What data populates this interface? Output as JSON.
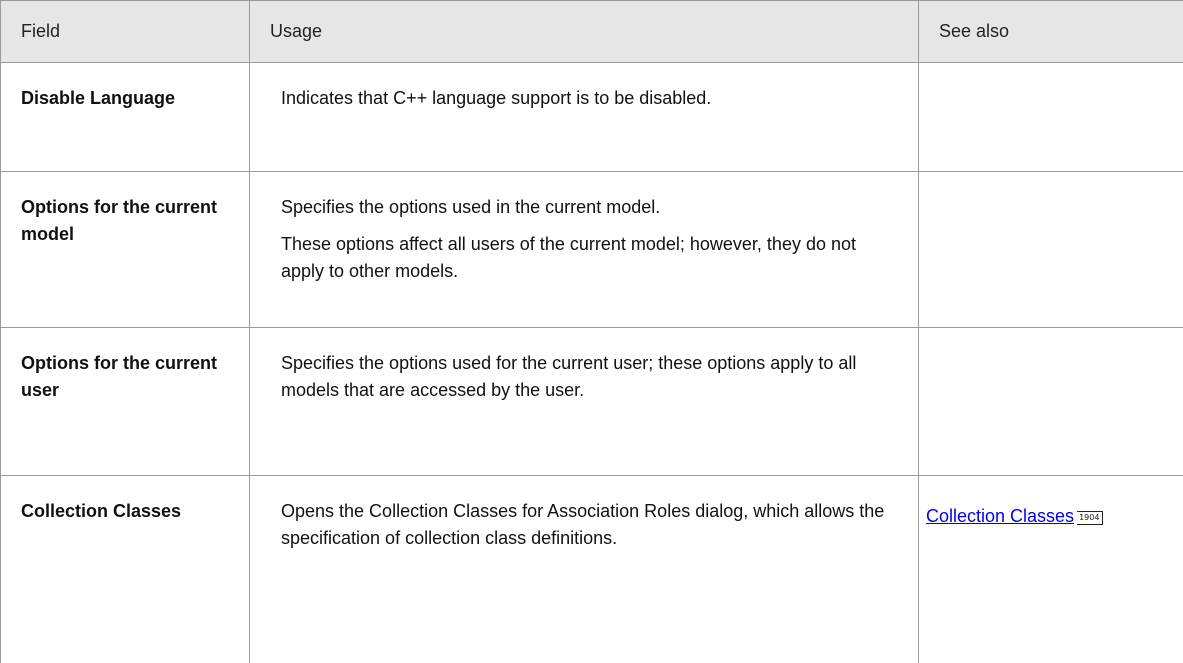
{
  "table": {
    "headers": [
      "Field",
      "Usage",
      "See also"
    ],
    "rows": [
      {
        "field": "Disable Language",
        "usage": [
          "Indicates that C++ language support is to be disabled."
        ],
        "see_also": null
      },
      {
        "field": "Options for the current model",
        "usage": [
          "Specifies the options used in the current model.",
          "These options affect all users of the current model; however, they do not apply to other models."
        ],
        "see_also": null
      },
      {
        "field": "Options for the current user",
        "usage": [
          "Specifies the options used for the current user; these options apply to all models that are accessed by the user."
        ],
        "see_also": null
      },
      {
        "field": "Collection Classes",
        "usage": [
          "Opens the Collection Classes for Association Roles dialog, which allows the specification of collection class definitions."
        ],
        "see_also": {
          "label": "Collection Classes",
          "page": "1904"
        }
      }
    ]
  }
}
